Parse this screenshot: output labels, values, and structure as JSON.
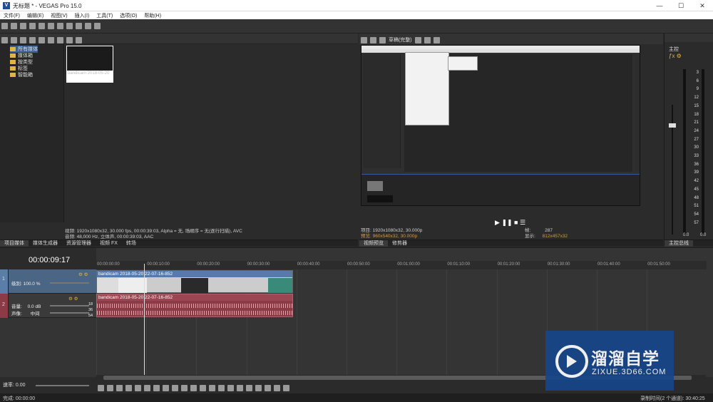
{
  "window": {
    "title": "无标题 * - VEGAS Pro 15.0",
    "logo": "V",
    "min": "—",
    "max": "☐",
    "close": "✕"
  },
  "menu": [
    "文件(F)",
    "编辑(E)",
    "视图(V)",
    "插入(I)",
    "工具(T)",
    "选项(O)",
    "帮助(H)"
  ],
  "media": {
    "tree": [
      "所有媒体",
      "媒体箱",
      "按类型",
      "标签",
      "智能箱"
    ],
    "thumb_label": "bandicam 2018-05-20",
    "info_video": "视频: 1920x1080x32, 30.000 fps, 00:00:39:03, Alpha = 无, 场顺序 = 无(逐行扫描), AVC",
    "info_audio": "音频: 48,000 Hz, 立体声, 00:00:39:03, AAC",
    "tabs": [
      "项目媒体",
      "媒体生成器",
      "资源管理器",
      "视频 FX",
      "转场"
    ]
  },
  "preview": {
    "mode": "草稿(完整)",
    "project": "项目: 1920x1080x32, 30.000p",
    "preview": "预览: 960x540x32, 30.000p",
    "frame_label": "帧:",
    "frame": "287",
    "display_label": "显示:",
    "display": "812x457x32",
    "tabs": [
      "视频预览",
      "修剪器"
    ]
  },
  "master": {
    "label": "主控",
    "scale": [
      "3",
      "6",
      "9",
      "12",
      "15",
      "18",
      "21",
      "24",
      "27",
      "30",
      "33",
      "36",
      "39",
      "42",
      "45",
      "48",
      "51",
      "54",
      "57"
    ],
    "values": [
      "0.0",
      "0.0"
    ],
    "tab": "主控总线"
  },
  "timeline": {
    "time": "00:00:09:17",
    "ruler": [
      "00:00:00:00",
      "00:00:10:00",
      "00:00:20:00",
      "00:00:30:00",
      "00:00:40:00",
      "00:00:50:00",
      "00:01:00:00",
      "00:01:10:00",
      "00:01:20:00",
      "00:01:30:00",
      "00:01:40:00",
      "00:01:50:00"
    ],
    "video_track": {
      "num": "1",
      "level_label": "级别:",
      "level": "100.0 %",
      "clip": "bandicam 2018-05-20 22-07-16-852"
    },
    "audio_track": {
      "num": "2",
      "vol_label": "音量:",
      "vol": "0.0 dB",
      "pan_label": "声像:",
      "pan": "中间",
      "clip": "bandicam 2018-05-20 22-07-16-852",
      "db": [
        "18",
        "36",
        "54"
      ]
    }
  },
  "rate": {
    "label": "速率: 0.00"
  },
  "status": {
    "left": "完成: 00:00:00",
    "right": "录制时间(2 个通道): 30:40:25"
  },
  "watermark": {
    "cn": "溜溜自学",
    "url": "ZIXUE.3D66.COM"
  }
}
